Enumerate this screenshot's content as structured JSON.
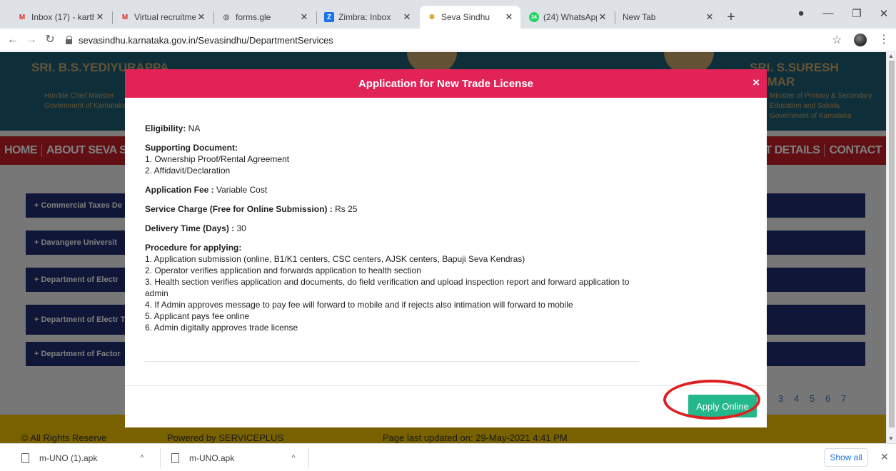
{
  "browser": {
    "tabs": [
      {
        "title": "Inbox (17) - karth",
        "icon": "gmail-icon",
        "icon_glyph": "M",
        "icon_color": "#d93025",
        "active": false
      },
      {
        "title": "Virtual recruitmen",
        "icon": "gmail-icon",
        "icon_glyph": "M",
        "icon_color": "#d93025",
        "active": false
      },
      {
        "title": "forms.gle",
        "icon": "globe-icon",
        "icon_glyph": "◎",
        "icon_color": "#5f6368",
        "active": false
      },
      {
        "title": "Zimbra: Inbox",
        "icon": "zimbra-icon",
        "icon_glyph": "Z",
        "icon_color": "#1a73e8",
        "active": false
      },
      {
        "title": "Seva Sindhu",
        "icon": "seva-sindhu-icon",
        "icon_glyph": "✱",
        "icon_color": "#e0a020",
        "active": true
      },
      {
        "title": "(24) WhatsApp",
        "icon": "whatsapp-icon",
        "icon_glyph": "24",
        "icon_color": "#25d366",
        "active": false
      },
      {
        "title": "New Tab",
        "icon": "",
        "icon_glyph": "",
        "icon_color": "",
        "active": false
      }
    ],
    "url": "sevasindhu.karnataka.gov.in/Sevasindhu/DepartmentServices",
    "close_glyph": "✕",
    "newtab_glyph": "+"
  },
  "background_page": {
    "banner_left_name": "SRI. B.S.YEDIYURAPPA",
    "banner_left_sub": "Hon'ble Chief Minister\nGovernment of Karnataka",
    "banner_right_name": "SRI. S.SURESH KUMAR",
    "banner_right_sub": "Minister of Primary & Secondary\nEducation and Sakala,\nGovernment of Karnataka",
    "nav_items": [
      "HOME",
      "ABOUT SEVA SINDHU",
      "",
      "",
      "",
      "",
      "",
      "",
      "",
      "ST DETAILS",
      "CONTACT"
    ],
    "departments": [
      "+ Commercial Taxes De",
      "+ Davangere Universit",
      "+ Department of Electr",
      "+ Department of Electr Technology and Scienc",
      "+ Department of Factor"
    ],
    "pager": [
      "3",
      "4",
      "5",
      "6",
      "7"
    ],
    "footer_rights": "© All Rights Reserve",
    "footer_powered": "Powered by SERVICEPLUS",
    "footer_updated": "Page last updated on: 29-May-2021 4:41 PM"
  },
  "modal": {
    "title": "Application for New Trade License",
    "close": "×",
    "eligibility_label": "Eligibility:",
    "eligibility_value": " NA",
    "supporting_label": "Supporting Document:",
    "supporting_items": [
      "1. Ownership Proof/Rental Agreement",
      "2. Affidavit/Declaration"
    ],
    "fee_label": "Application Fee :",
    "fee_value": " Variable Cost",
    "service_label": "Service Charge (Free for Online Submission) :",
    "service_value": " Rs 25",
    "delivery_label": "Delivery Time (Days) :",
    "delivery_value": " 30",
    "procedure_label": "Procedure for applying:",
    "procedure_items": [
      "1. Application submission (online, B1/K1 centers, CSC centers, AJSK centers, Bapuji Seva Kendras)",
      "2. Operator verifies application and forwards application to health section",
      "3. Health section verifies application and documents, do field verification and upload inspection report and forward application to admin",
      "4. If Admin approves message to pay fee will forward to mobile and if rejects also intimation will forward to mobile",
      "5. Applicant pays fee online",
      "6. Admin digitally approves trade license"
    ],
    "apply_button": "Apply Online",
    "highlight_color": "#e02020",
    "button_color": "#24b78c",
    "header_color": "#e22358"
  },
  "downloads": {
    "items": [
      {
        "name": "m-UNO (1).apk",
        "icon": "file-icon"
      },
      {
        "name": "m-UNO.apk",
        "icon": "file-icon"
      }
    ],
    "caret": "^",
    "show_all": "Show all",
    "close": "✕"
  }
}
